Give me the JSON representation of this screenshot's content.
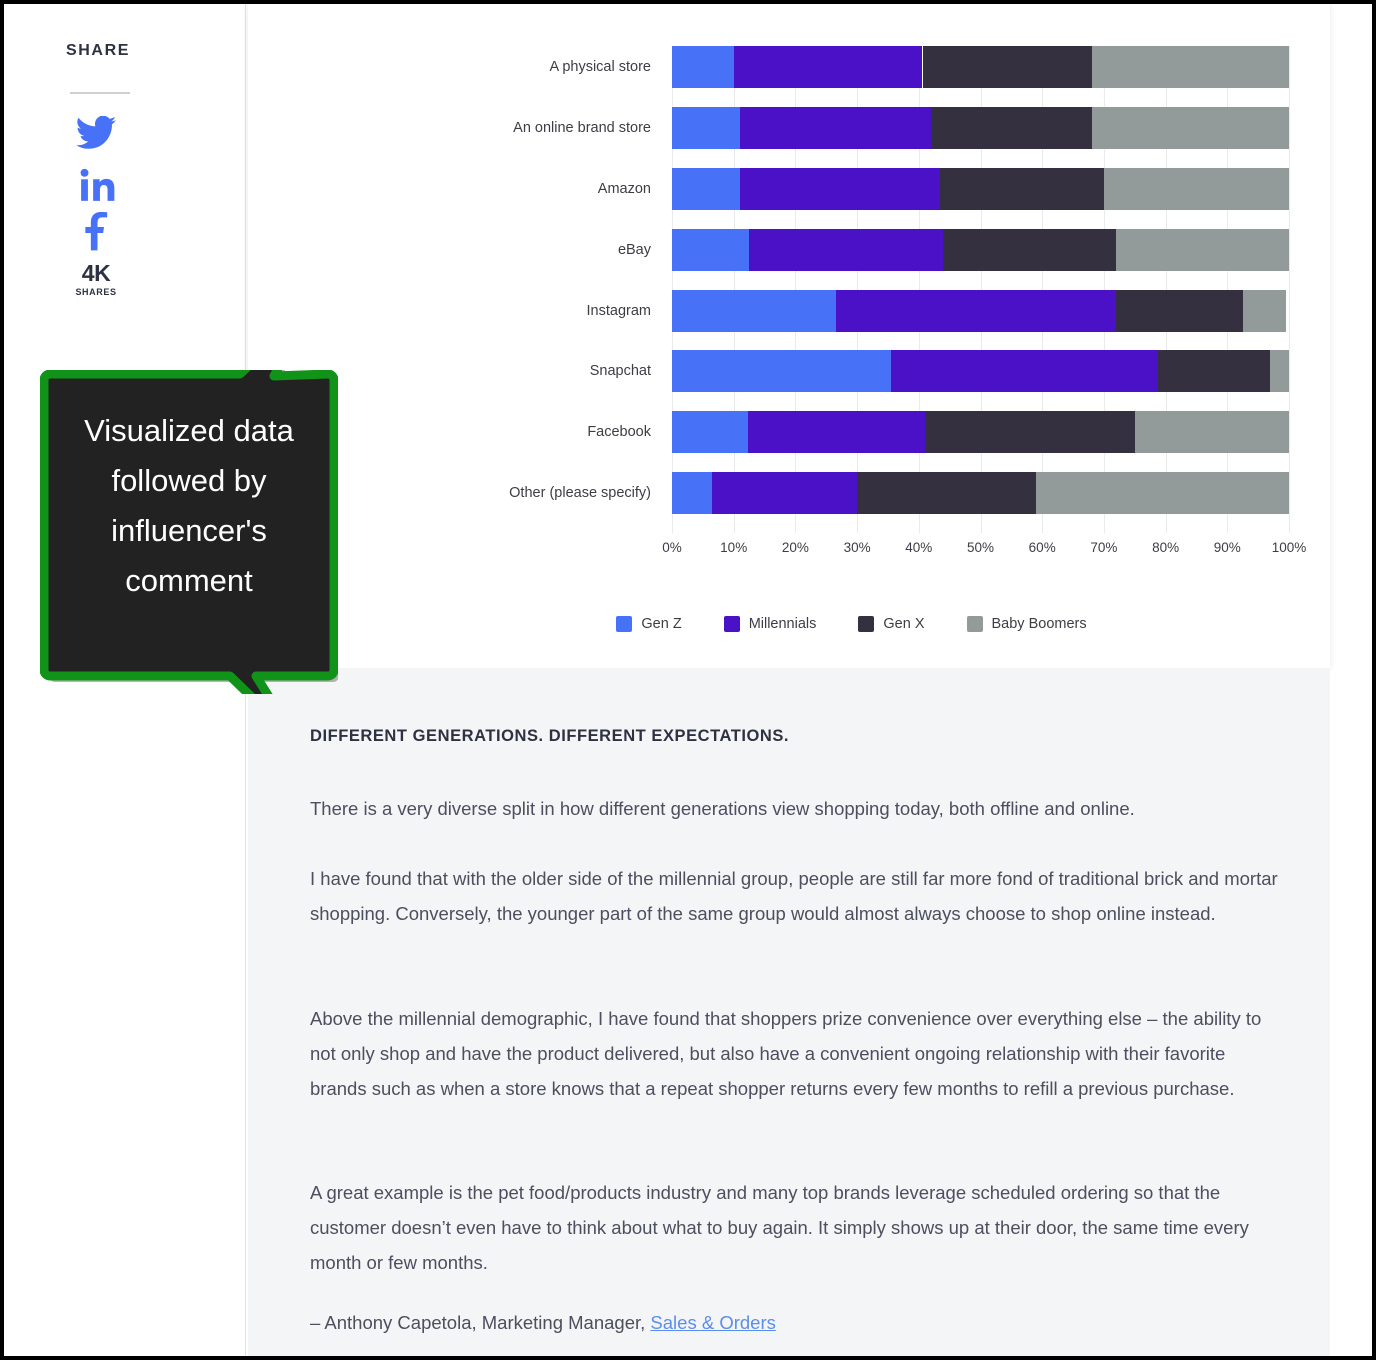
{
  "share": {
    "title": "SHARE",
    "icons": [
      {
        "name": "twitter-icon",
        "glyph": "🐦"
      },
      {
        "name": "linkedin-icon",
        "glyph": "in"
      },
      {
        "name": "facebook-icon",
        "glyph": "f"
      }
    ],
    "count": "4K",
    "count_label": "SHARES",
    "brand_color": "#4772F7"
  },
  "callout": {
    "text": "Visualized data followed by influencer's comment",
    "fill": "#222222",
    "border": "#109318"
  },
  "chart_data": {
    "type": "bar",
    "orientation": "horizontal",
    "stacked": true,
    "stack_mode": "percent",
    "title": "",
    "xlabel": "",
    "ylabel": "",
    "xlim": [
      0,
      100
    ],
    "grid": true,
    "legend_position": "bottom",
    "xticks": [
      "0%",
      "10%",
      "20%",
      "30%",
      "40%",
      "50%",
      "60%",
      "70%",
      "80%",
      "90%",
      "100%"
    ],
    "xtick_values": [
      0,
      10,
      20,
      30,
      40,
      50,
      60,
      70,
      80,
      90,
      100
    ],
    "categories": [
      "A physical store",
      "An online brand store",
      "Amazon",
      "eBay",
      "Instagram",
      "Snapchat",
      "Facebook",
      "Other (please specify)"
    ],
    "series": [
      {
        "name": "Gen Z",
        "color": "#4772F7",
        "values": [
          10,
          11,
          11,
          12.5,
          26.5,
          35.5,
          12.3,
          6.5
        ]
      },
      {
        "name": "Millennials",
        "color": "#4A11C6",
        "values": [
          30.6,
          31,
          32.5,
          31.5,
          45.5,
          43.2,
          28.7,
          23.5
        ]
      },
      {
        "name": "Gen X",
        "color": "#353040",
        "values": [
          27.4,
          26,
          26.5,
          28,
          20.5,
          18.3,
          34,
          29
        ]
      },
      {
        "name": "Baby Boomers",
        "color": "#939A9A",
        "values": [
          32,
          32,
          30,
          28,
          7,
          3,
          25,
          41
        ]
      }
    ]
  },
  "article": {
    "heading": "DIFFERENT GENERATIONS. DIFFERENT EXPECTATIONS.",
    "paragraphs": [
      "There is a very diverse split in how different generations view shopping today, both offline and online.",
      "I have found that with the older side of the millennial group, people are still far more fond of traditional brick and mortar shopping. Conversely, the younger part of the same group would almost always choose to shop online instead.",
      "Above the millennial demographic, I have found that shoppers prize convenience over everything else – the ability to not only shop and have the product delivered, but also have a convenient ongoing relationship with their favorite brands such as when a store knows that a repeat shopper returns every few months to refill a previous purchase.",
      "A great example is the pet food/products industry and many top brands leverage scheduled ordering so that the customer doesn’t even have to think about what to buy again. It simply shows up at their door, the same time every month or few months."
    ],
    "attribution_prefix": "– Anthony Capetola, Marketing Manager, ",
    "attribution_link": "Sales & Orders"
  }
}
